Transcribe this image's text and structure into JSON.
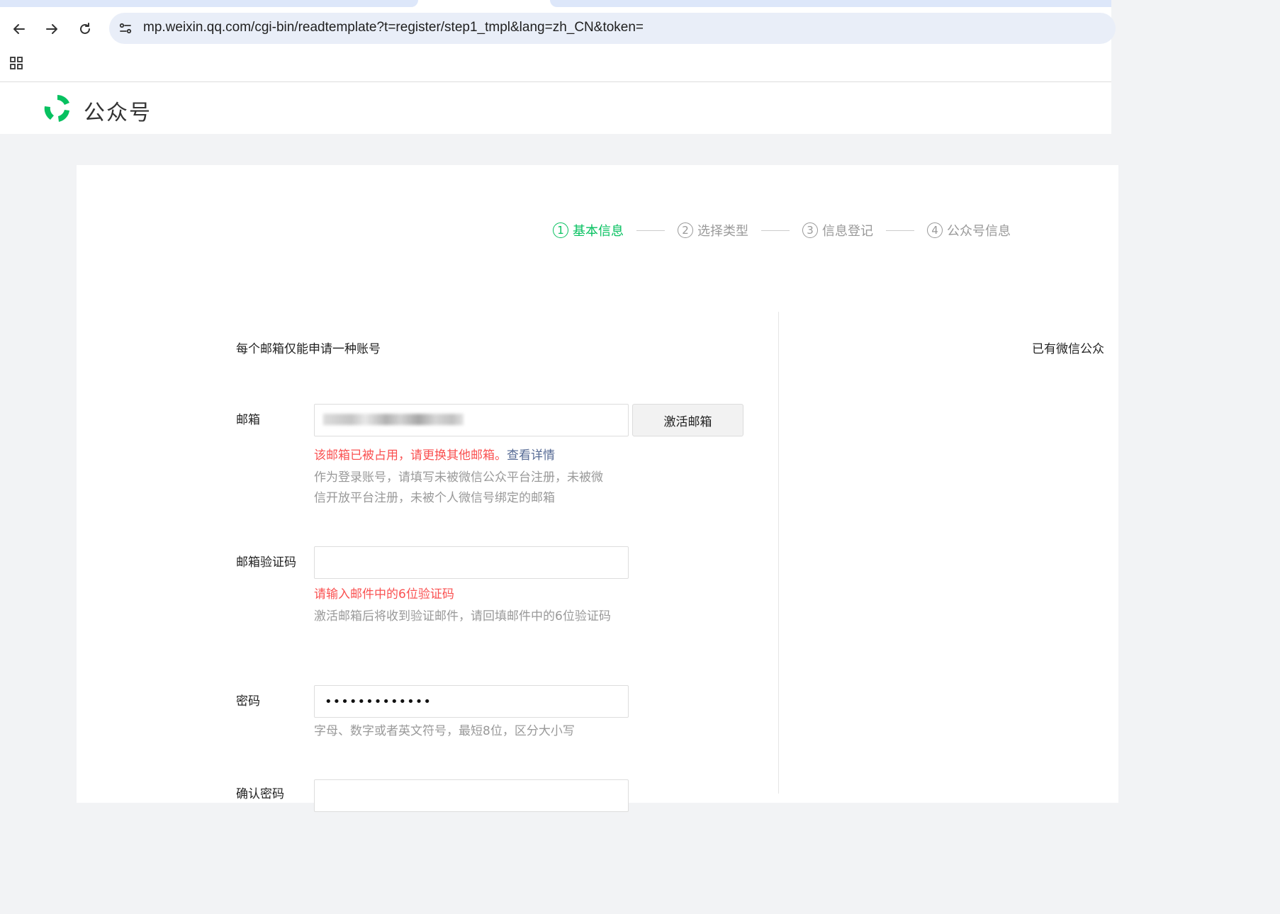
{
  "browser": {
    "url": "mp.weixin.qq.com/cgi-bin/readtemplate?t=register/step1_tmpl&lang=zh_CN&token="
  },
  "header": {
    "brand": "公众号"
  },
  "steps": [
    {
      "num": "1",
      "label": "基本信息",
      "active": true
    },
    {
      "num": "2",
      "label": "选择类型",
      "active": false
    },
    {
      "num": "3",
      "label": "信息登记",
      "active": false
    },
    {
      "num": "4",
      "label": "公众号信息",
      "active": false
    }
  ],
  "form": {
    "intro": "每个邮箱仅能申请一种账号",
    "right_note": "已有微信公众",
    "email": {
      "label": "邮箱",
      "button": "激活邮箱",
      "error": "该邮箱已被占用，请更换其他邮箱。",
      "error_link": "查看详情",
      "tip": "作为登录账号，请填写未被微信公众平台注册，未被微信开放平台注册，未被个人微信号绑定的邮箱"
    },
    "code": {
      "label": "邮箱验证码",
      "value": "",
      "error": "请输入邮件中的6位验证码",
      "tip": "激活邮箱后将收到验证邮件，请回填邮件中的6位验证码"
    },
    "password": {
      "label": "密码",
      "value": "•••••••••••••",
      "tip": "字母、数字或者英文符号，最短8位，区分大小写"
    },
    "confirm": {
      "label": "确认密码"
    }
  },
  "colors": {
    "accent": "#07c160",
    "error": "#fa5151",
    "link": "#576b95"
  }
}
